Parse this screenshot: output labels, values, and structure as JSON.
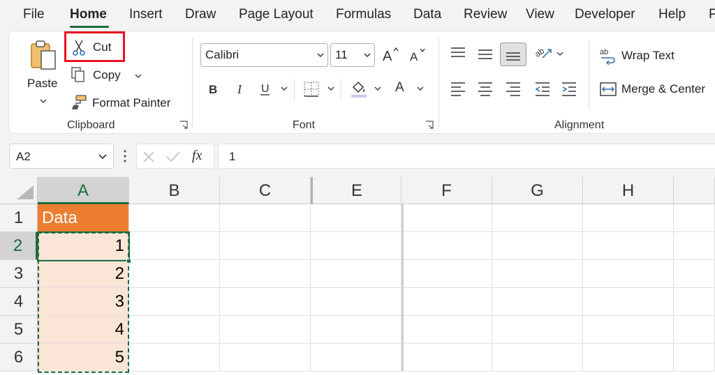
{
  "menu": {
    "tabs": [
      "File",
      "Home",
      "Insert",
      "Draw",
      "Page Layout",
      "Formulas",
      "Data",
      "Review",
      "View",
      "Developer",
      "Help",
      "P"
    ],
    "active": "Home"
  },
  "ribbon": {
    "clipboard": {
      "paste_label": "Paste",
      "cut_label": "Cut",
      "copy_label": "Copy",
      "format_painter_label": "Format Painter",
      "group_label": "Clipboard"
    },
    "font": {
      "font_name": "Calibri",
      "font_size": "11",
      "group_label": "Font"
    },
    "alignment": {
      "wrap_text_label": "Wrap Text",
      "merge_center_label": "Merge & Center",
      "group_label": "Alignment"
    },
    "highlight_color": "#e81123"
  },
  "formula_bar": {
    "name_box": "A2",
    "fx_label": "fx",
    "value": "1"
  },
  "sheet": {
    "columns": [
      "A",
      "B",
      "C",
      "E",
      "F",
      "G",
      "H"
    ],
    "rows": [
      "1",
      "2",
      "3",
      "4",
      "5",
      "6"
    ],
    "cells": {
      "A1": "Data",
      "A2": "1",
      "A3": "2",
      "A4": "3",
      "A5": "4",
      "A6": "5"
    },
    "header_fill": "#ed7d31",
    "data_fill": "#fbe5d6",
    "accent": "#1e6b3f"
  }
}
